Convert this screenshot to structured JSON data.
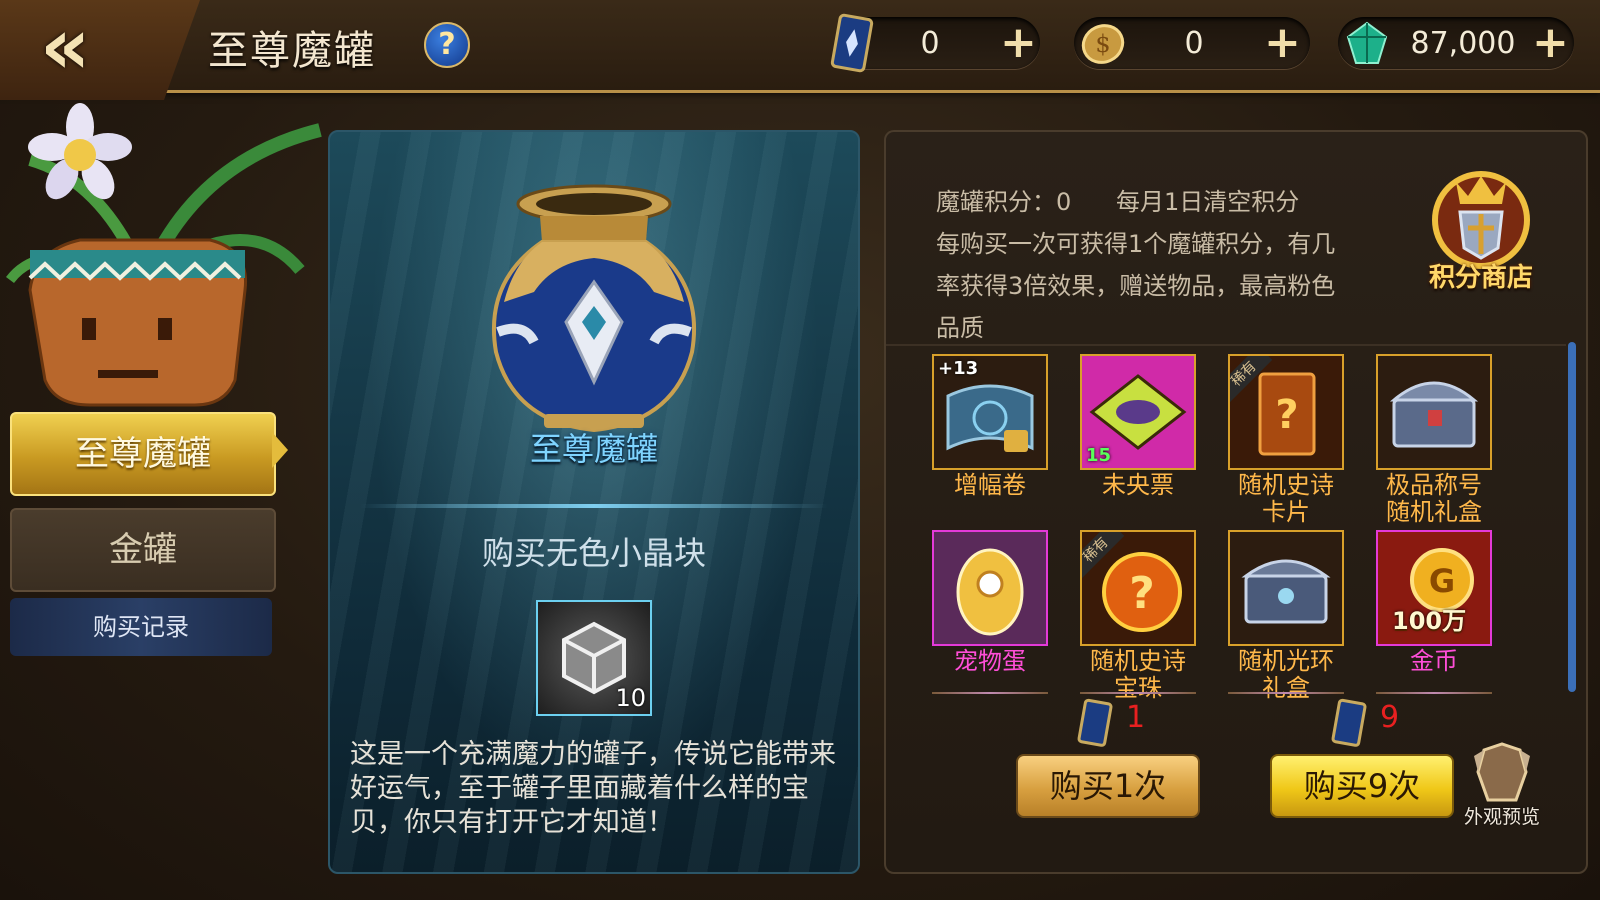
{
  "header": {
    "title": "至尊魔罐",
    "help_symbol": "?",
    "back_symbol": "«"
  },
  "currencies": [
    {
      "icon": "card-ticket-icon",
      "amount": "0"
    },
    {
      "icon": "gold-coin-icon",
      "amount": "0"
    },
    {
      "icon": "green-crystal-icon",
      "amount": "87,000"
    }
  ],
  "plus_symbol": "+",
  "menu": {
    "items": [
      {
        "label": "至尊魔罐",
        "active": true
      },
      {
        "label": "金罐",
        "active": false
      }
    ],
    "record_label": "购买记录"
  },
  "jar": {
    "name": "至尊魔罐",
    "buy_item_label": "购买无色小晶块",
    "item_count": "10",
    "description": "这是一个充满魔力的罐子，传说它能带来好运气，至于罐子里面藏着什么样的宝贝，你只有打开它才知道！"
  },
  "info": {
    "score_label": "魔罐积分：0",
    "reset_note": "每月1日清空积分",
    "rule_lines": [
      "每购买一次可获得1个魔罐积分，有几",
      "率获得3倍效果，赠送物品，最高粉色",
      "品质"
    ],
    "score_shop_label": "积分商店"
  },
  "prizes": [
    {
      "label": "增幅卷",
      "tag": "+13",
      "rarity": "orange"
    },
    {
      "label": "未央票",
      "tag": "15",
      "rarity": "orange"
    },
    {
      "label": "随机史诗卡片",
      "tag": "稀有",
      "rarity": "orange"
    },
    {
      "label": "极品称号随机礼盒",
      "tag": "",
      "rarity": "orange"
    },
    {
      "label": "宠物蛋",
      "tag": "",
      "rarity": "pink"
    },
    {
      "label": "随机史诗宝珠",
      "tag": "稀有",
      "rarity": "orange"
    },
    {
      "label": "随机光环礼盒",
      "tag": "",
      "rarity": "orange"
    },
    {
      "label": "金币",
      "tag": "100万",
      "rarity": "pink"
    }
  ],
  "purchase": {
    "once": {
      "cost": "1",
      "label": "购买1次"
    },
    "nine": {
      "cost": "9",
      "label": "购买9次"
    },
    "preview_label": "外观预览"
  },
  "colors": {
    "accent_gold": "#d8a02a",
    "pink_quality": "#e43ad8",
    "price_red": "#e82020",
    "jar_name_blue": "#7fd4ff"
  }
}
